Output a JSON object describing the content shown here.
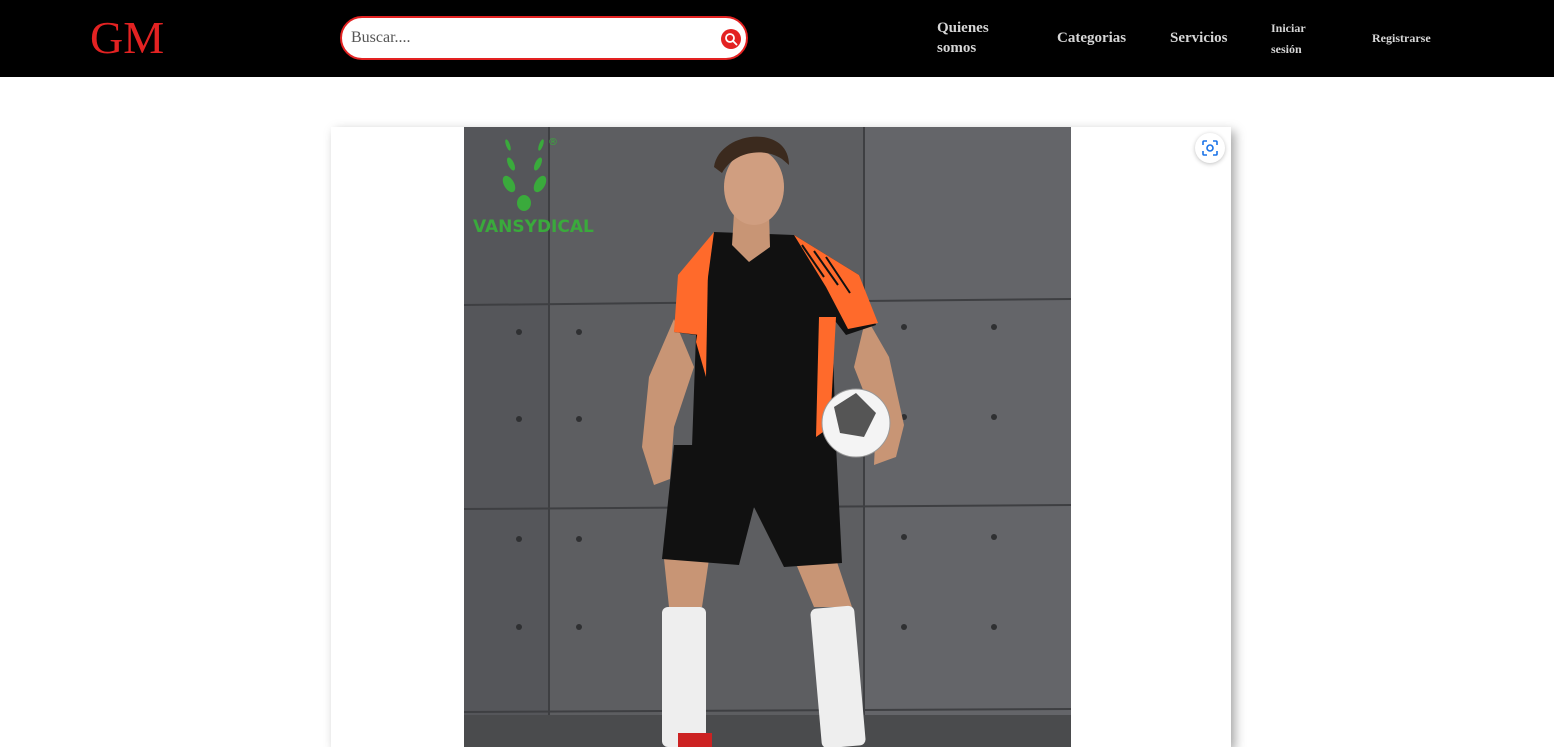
{
  "header": {
    "logo": "GM",
    "search": {
      "placeholder": "Buscar...."
    },
    "nav": {
      "about": "Quienes somos",
      "categories": "Categorias",
      "services": "Servicios",
      "login": "Iniciar sesión",
      "register": "Registrarse"
    }
  },
  "product": {
    "brand_logo_text": "VANSYDICAL",
    "brand_logo_mark": "®"
  },
  "colors": {
    "header_bg": "#000000",
    "accent": "#e32222",
    "nav_text": "#d6d6d6",
    "brand_green": "#3aaa3c",
    "zoom_icon": "#1a73e8"
  },
  "icons": {
    "search": "search-icon",
    "zoom": "visual-search-icon"
  }
}
